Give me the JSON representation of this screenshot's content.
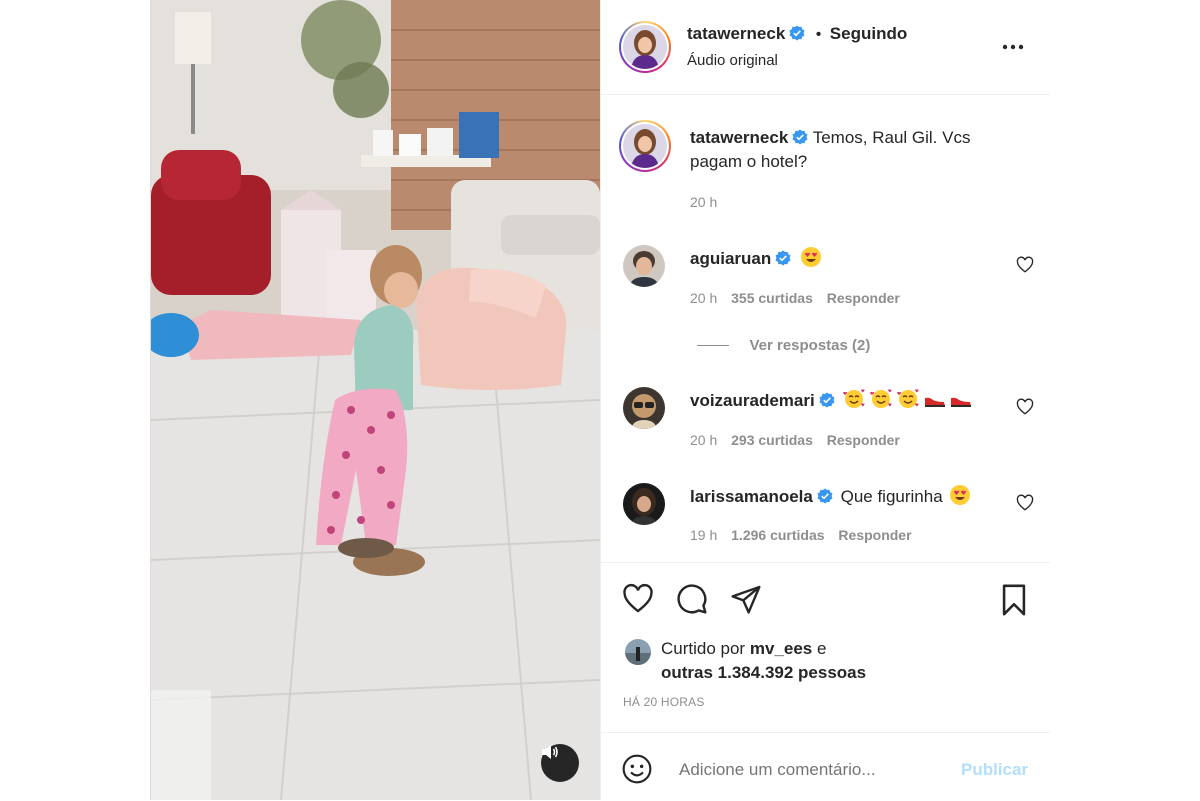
{
  "post": {
    "author": "tatawerneck",
    "follow_status": "Seguindo",
    "separator": "•",
    "audio": "Áudio original"
  },
  "caption": {
    "author": "tatawerneck",
    "text": "Temos, Raul Gil. Vcs pagam o hotel?",
    "line1": "Temos, Raul Gil. Vcs",
    "line2": "pagam o hotel?",
    "time": "20 h"
  },
  "comments": [
    {
      "user": "aguiaruan",
      "text_emoji": "heart-eyes",
      "time": "20 h",
      "likes": "355 curtidas",
      "reply": "Responder"
    },
    {
      "user": "voizaurademari",
      "text_emoji": "smiling-hearts x3, red-shoes x2",
      "time": "20 h",
      "likes": "293 curtidas",
      "reply": "Responder"
    },
    {
      "user": "larissamanoela",
      "text": "Que figurinha",
      "time": "19 h",
      "likes": "1.296 curtidas",
      "reply": "Responder"
    }
  ],
  "view_replies": "Ver respostas (2)",
  "likes": {
    "prefix": "Curtido por",
    "user": "mv_ees",
    "conj": "e",
    "others": "outras 1.384.392 pessoas"
  },
  "timestamp": "HÁ 20 HORAS",
  "comment_input": {
    "placeholder": "Adicione um comentário...",
    "publish": "Publicar"
  },
  "colors": {
    "verified": "#3897f0",
    "publish_disabled": "#b2dffc",
    "meta": "#8e8e8e"
  }
}
